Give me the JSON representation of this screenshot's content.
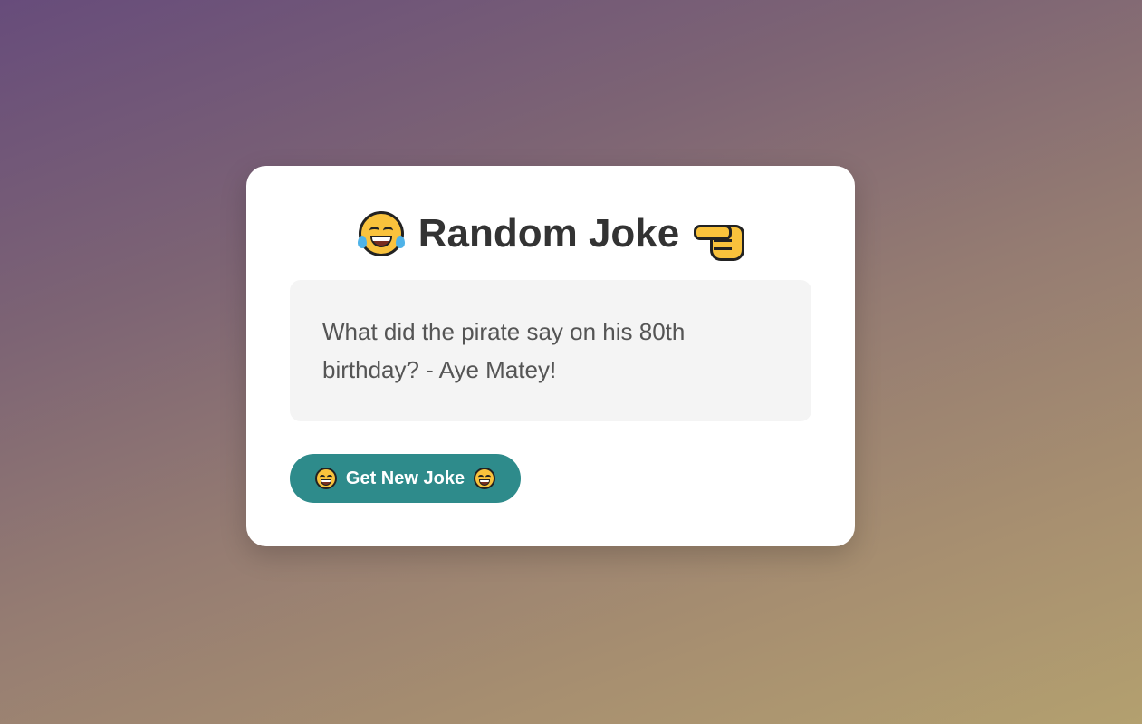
{
  "card": {
    "title": "Random Joke",
    "title_left_icon": "laughing-face-icon",
    "title_right_icon": "pointing-hand-icon",
    "joke_text": "What did the pirate say on his 80th birthday? - Aye Matey!",
    "button": {
      "label": "Get New Joke",
      "icon": "laughing-face-icon",
      "color": "#2e8b8b"
    }
  }
}
